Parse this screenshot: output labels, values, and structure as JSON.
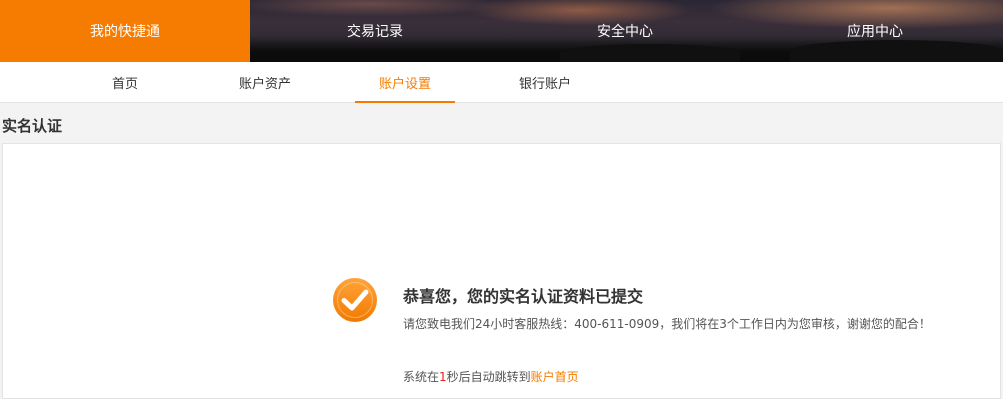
{
  "top_nav": {
    "tabs": [
      {
        "label": "我的快捷通",
        "active": true
      },
      {
        "label": "交易记录",
        "active": false
      },
      {
        "label": "安全中心",
        "active": false
      },
      {
        "label": "应用中心",
        "active": false
      }
    ]
  },
  "sub_nav": {
    "items": [
      {
        "label": "首页",
        "active": false
      },
      {
        "label": "账户资产",
        "active": false
      },
      {
        "label": "账户设置",
        "active": true
      },
      {
        "label": "银行账户",
        "active": false
      }
    ]
  },
  "section": {
    "title": "实名认证"
  },
  "result": {
    "icon": "check-circle-icon",
    "title": "恭喜您，您的实名认证资料已提交",
    "message": "请您致电我们24小时客服热线：400-611-0909，我们将在3个工作日内为您审核，谢谢您的配合！",
    "redirect_prefix": "系统在",
    "redirect_seconds": "1",
    "redirect_middle": "秒后自动跳转到",
    "redirect_link": "账户首页"
  },
  "colors": {
    "accent": "#f57c00",
    "countdown": "#e62117"
  }
}
